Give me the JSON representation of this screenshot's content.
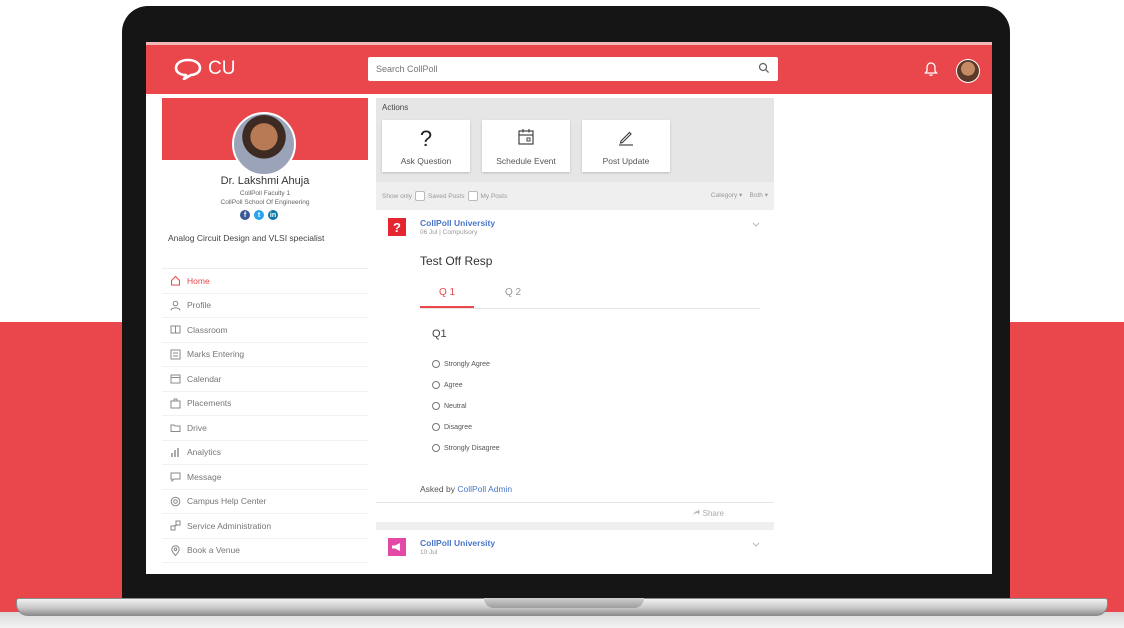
{
  "app": {
    "logo_text": "CU",
    "brand_color": "#e9474b",
    "link_color": "#4a76c6"
  },
  "search": {
    "placeholder": "Search CollPoll"
  },
  "header_icons": [
    "search-icon",
    "bell-icon",
    "user-avatar"
  ],
  "profile": {
    "name": "Dr. Lakshmi Ahuja",
    "role": "CollPoll Faculty 1",
    "school": "CollPoll School Of Engineering",
    "social_icons": [
      "facebook-icon",
      "twitter-icon",
      "linkedin-icon"
    ],
    "bio": "Analog Circuit Design and VLSI specialist"
  },
  "sidebar": {
    "items": [
      {
        "label": "Home",
        "icon": "home-icon",
        "active": true
      },
      {
        "label": "Profile",
        "icon": "user-icon"
      },
      {
        "label": "Classroom",
        "icon": "book-icon"
      },
      {
        "label": "Marks Entering",
        "icon": "marks-icon"
      },
      {
        "label": "Calendar",
        "icon": "calendar-icon"
      },
      {
        "label": "Placements",
        "icon": "placements-icon"
      },
      {
        "label": "Drive",
        "icon": "folder-icon"
      },
      {
        "label": "Analytics",
        "icon": "analytics-icon"
      },
      {
        "label": "Message",
        "icon": "message-icon"
      },
      {
        "label": "Campus Help Center",
        "icon": "help-icon"
      },
      {
        "label": "Service Administration",
        "icon": "service-icon"
      },
      {
        "label": "Book a Venue",
        "icon": "location-icon"
      }
    ]
  },
  "actions": {
    "title": "Actions",
    "items": [
      {
        "label": "Ask Question",
        "icon": "question-icon"
      },
      {
        "label": "Schedule Event",
        "icon": "calendar-icon"
      },
      {
        "label": "Post Update",
        "icon": "pencil-icon"
      }
    ]
  },
  "filters": {
    "show_only": "Show only",
    "saved_posts": "Saved Posts",
    "my_posts": "My Posts",
    "category": "Category",
    "both": "Both"
  },
  "posts": [
    {
      "author": "CollPoll University",
      "date": "06 Jul | Compulsory",
      "title": "Test Off Resp",
      "tabs": [
        "Q 1",
        "Q 2"
      ],
      "active_tab": "Q 1",
      "question": "Q1",
      "options": [
        "Strongly Agree",
        "Agree",
        "Neutral",
        "Disagree",
        "Strongly Disagree"
      ],
      "asked_by_prefix": "Asked by",
      "asked_by": "CollPoll Admin",
      "share_label": "Share",
      "icon": "question-icon",
      "icon_color": "#e5252f"
    },
    {
      "author": "CollPoll University",
      "date": "10 Jul",
      "icon": "megaphone-icon",
      "icon_color": "#e24aa6"
    }
  ]
}
